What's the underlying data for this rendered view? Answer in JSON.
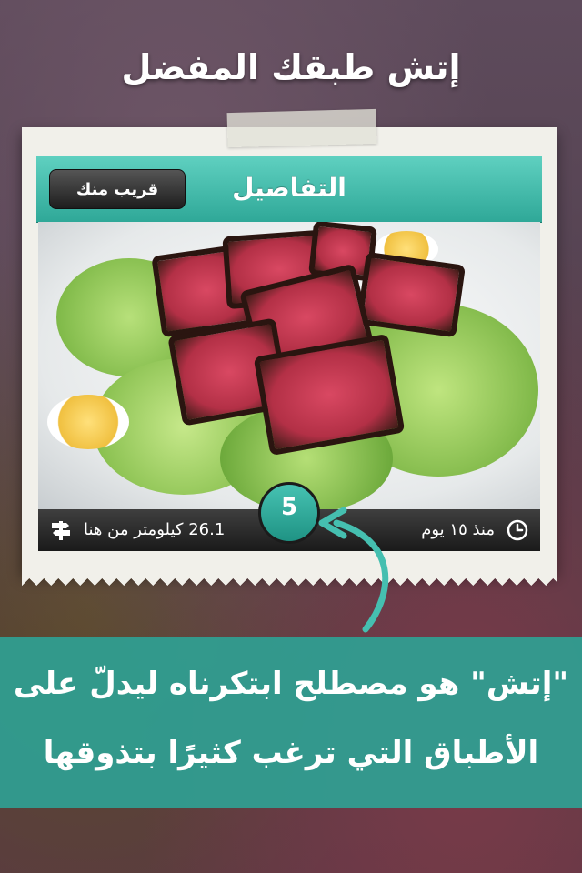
{
  "headline": "إتش طبقك المفضل",
  "navbar": {
    "title": "التفاصيل",
    "back_label": "قريب منك"
  },
  "info_bar": {
    "distance": "26.1 كيلومتر من هنا",
    "time": "منذ ١٥ يوم",
    "rating": "5"
  },
  "banner": {
    "line1": "\"إتش\" هو مصطلح ابتكرناه ليدلّ على",
    "line2": "الأطباق التي ترغب كثيرًا بتذوقها"
  },
  "colors": {
    "accent": "#2fa898",
    "banner": "#2f9f92",
    "dark_bar": "#1a1a1a"
  }
}
